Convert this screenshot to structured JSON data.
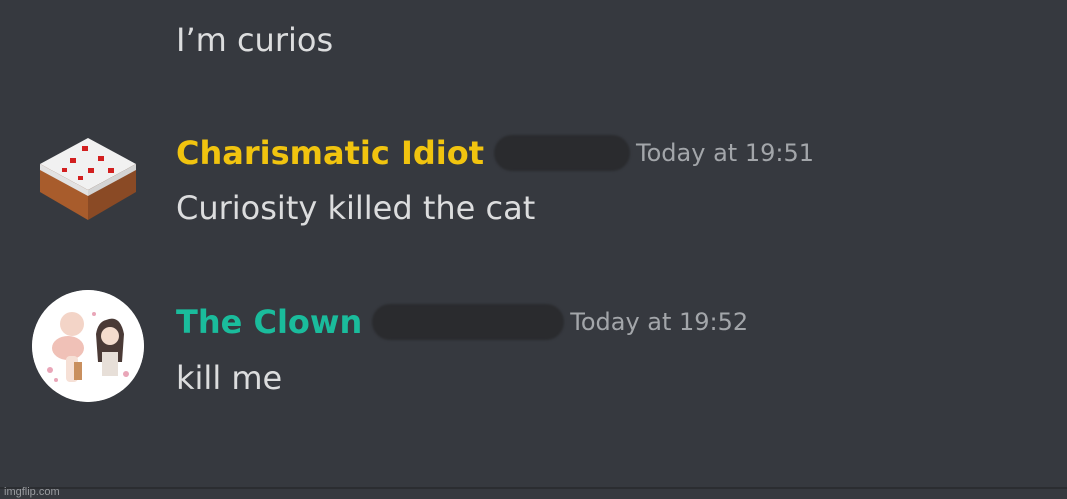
{
  "messages": [
    {
      "text": "I’m curios"
    },
    {
      "username": "Charismatic Idiot",
      "username_color": "#f1c40f",
      "timestamp": "Today at 19:51",
      "text": "Curiosity killed the cat",
      "avatar": "cake-block-avatar"
    },
    {
      "username": "The Clown",
      "username_color": "#1abc9c",
      "timestamp": "Today at 19:52",
      "text": "kill me",
      "avatar": "anime-characters-avatar"
    }
  ],
  "watermark": "imgflip.com",
  "colors": {
    "background": "#36393f",
    "message_text": "#dcddde",
    "timestamp": "#a3a6aa"
  }
}
